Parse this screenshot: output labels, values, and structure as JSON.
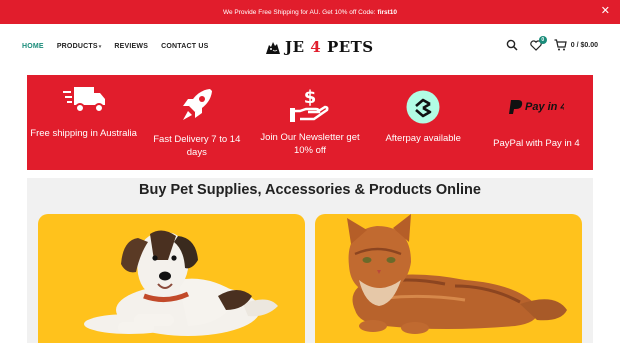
{
  "topbar": {
    "message": "We Provide Free Shipping for AU. Get 10% off Code:",
    "code": "first10",
    "close_icon": "close-icon"
  },
  "nav": {
    "home": "HOME",
    "products": "PRODUCTS",
    "reviews": "REVIEWS",
    "contact": "CONTACT US"
  },
  "logo": {
    "prefix": "JE",
    "number": "4",
    "suffix": "PETS",
    "icon": "pet-silhouette-logo"
  },
  "header_icons": {
    "search": "search-icon",
    "wishlist": "heart-icon",
    "wishlist_count": "0",
    "cart": "cart-icon",
    "cart_summary": "0 / $0.00"
  },
  "features": [
    {
      "label": "Free shipping in Australia",
      "icon": "truck-icon"
    },
    {
      "label": "Fast Delivery 7 to 14 days",
      "icon": "rocket-icon"
    },
    {
      "label": "Join Our Newsletter get 10% off",
      "icon": "hand-dollar-icon"
    },
    {
      "label": "Afterpay available",
      "icon": "afterpay-icon"
    },
    {
      "label": "PayPal with Pay in 4",
      "icon": "paypal-payin4-icon",
      "badge_text": "Pay in 4"
    }
  ],
  "main": {
    "heading": "Buy Pet Supplies, Accessories & Products Online"
  },
  "colors": {
    "brand_red": "#e11d2c",
    "accent_teal": "#1a8c7a",
    "card_yellow": "#ffc21c",
    "afterpay_mint": "#b2fce4"
  }
}
